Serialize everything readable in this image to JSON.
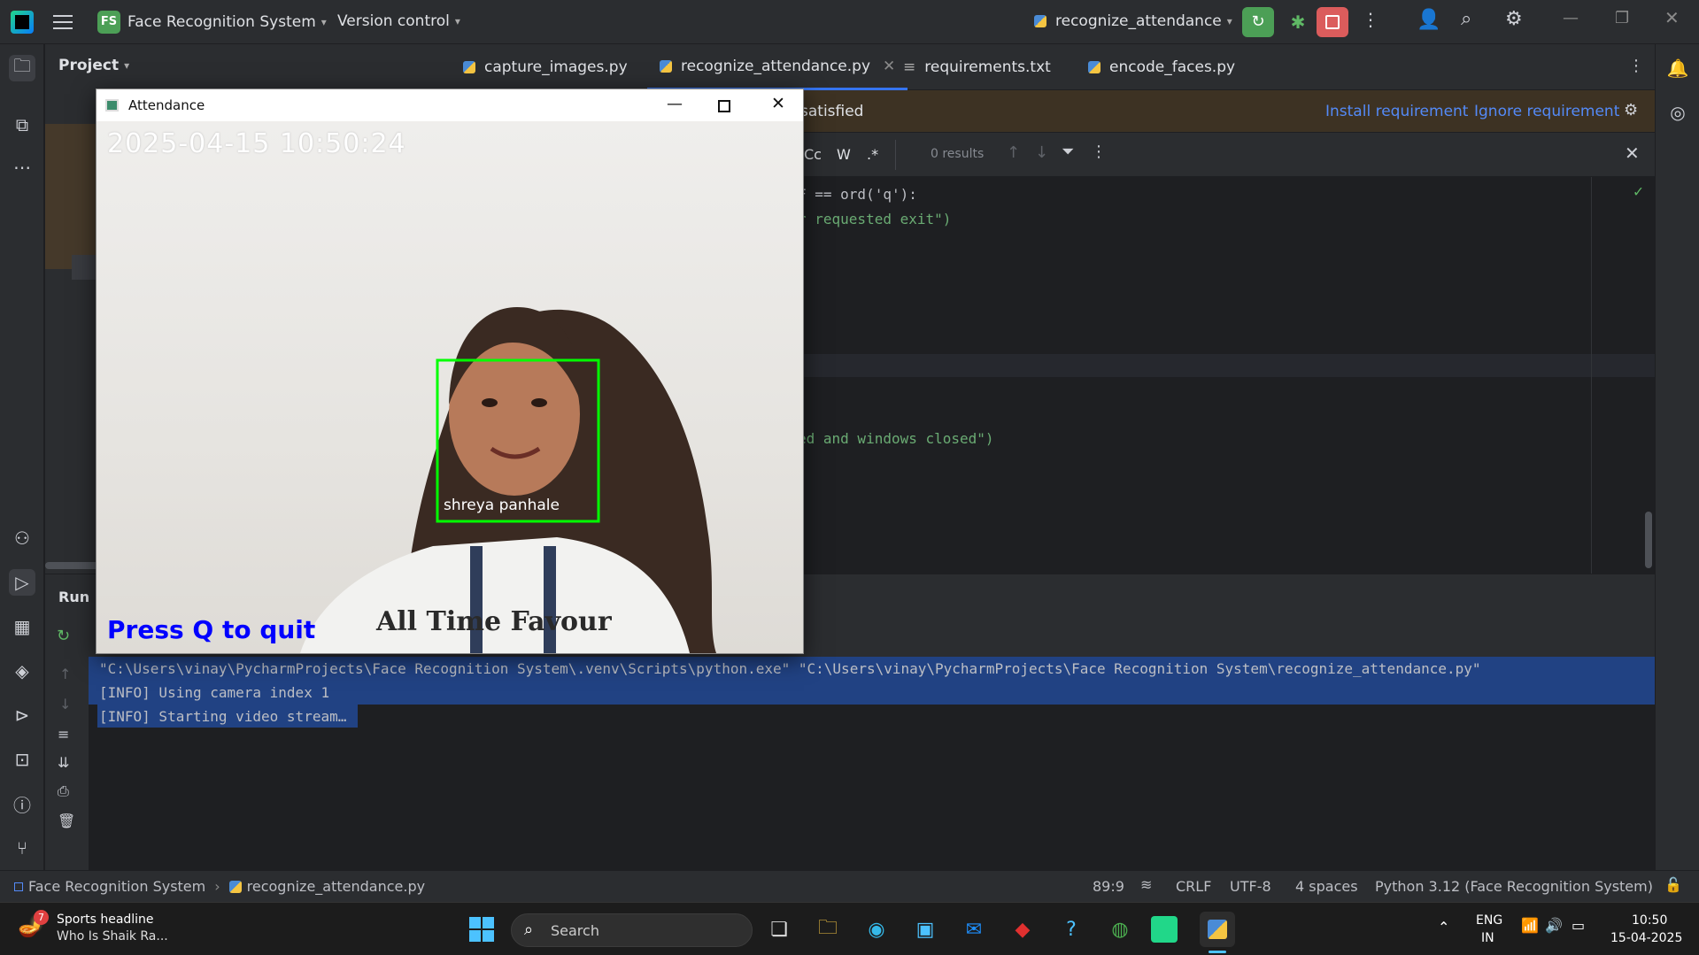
{
  "titlebar": {
    "project_badge": "FS",
    "project_name": "Face Recognition System",
    "version_control": "Version control",
    "run_config": "recognize_attendance"
  },
  "project_panel": {
    "title": "Project"
  },
  "tabs": [
    {
      "label": "capture_images.py"
    },
    {
      "label": "recognize_attendance.py"
    },
    {
      "label": "requirements.txt"
    },
    {
      "label": "encode_faces.py"
    }
  ],
  "banner": {
    "text": "satisfied",
    "install": "Install requirement",
    "ignore": "Ignore requirement"
  },
  "findbar": {
    "case": "Cc",
    "word": "W",
    "regex": ".*",
    "results": "0 results"
  },
  "code": {
    "line1": "F == ord('q'):",
    "line2": "r requested exit\")",
    "line3": "ed and windows closed\")"
  },
  "run": {
    "title": "Run",
    "console": [
      "\"C:\\Users\\vinay\\PycharmProjects\\Face Recognition System\\.venv\\Scripts\\python.exe\" \"C:\\Users\\vinay\\PycharmProjects\\Face Recognition System\\recognize_attendance.py\"",
      "[INFO] Using camera index 1",
      "[INFO] Starting video stream…"
    ]
  },
  "statusbar": {
    "project": "Face Recognition System",
    "file": "recognize_attendance.py",
    "position": "89:9",
    "line_ending": "CRLF",
    "encoding": "UTF-8",
    "indent": "4 spaces",
    "interpreter": "Python 3.12 (Face Recognition System)"
  },
  "attendance_window": {
    "title": "Attendance",
    "timestamp": "2025-04-15 10:50:24",
    "face_label": "shreya panhale",
    "quit_hint": "Press Q to quit",
    "shirt_text": "All Time Favour"
  },
  "taskbar": {
    "news_title": "Sports headline",
    "news_sub": "Who Is Shaik Ra...",
    "news_badge": "7",
    "search_placeholder": "Search",
    "lang1": "ENG",
    "lang2": "IN",
    "time": "10:50",
    "date": "15-04-2025"
  },
  "colors": {
    "accent": "#3574f0",
    "run_green": "#4c9f56",
    "stop_red": "#db5c5c",
    "face_box": "#00ff00",
    "quit_text": "#0000ff"
  }
}
